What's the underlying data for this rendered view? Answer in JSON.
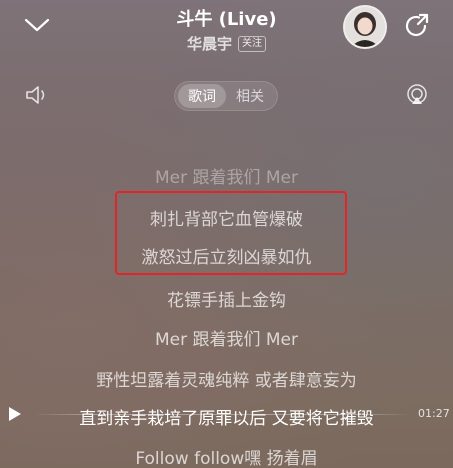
{
  "header": {
    "song_title": "斗牛 (Live)",
    "artist": "华晨宇",
    "follow_label": "关注",
    "icons": {
      "collapse": "chevron-down-icon",
      "share": "share-icon"
    }
  },
  "toolbar": {
    "tabs": [
      {
        "label": "歌词",
        "active": true
      },
      {
        "label": "相关",
        "active": false
      }
    ],
    "icons": {
      "volume": "volume-icon",
      "cast": "airplay-icon"
    }
  },
  "lyrics": {
    "lines": [
      "Mer 跟着我们 Mer",
      "刺扎背部它血管爆破",
      "激怒过后立刻凶暴如仇",
      "花镖手插上金钩",
      "Mer 跟着我们 Mer",
      "野性坦露着灵魂纯粹 或者肆意妄为",
      "直到亲手栽培了原罪以后 又要将它摧毁",
      "Follow follow嘿 扬着眉"
    ],
    "current_index": 6,
    "highlight_color": "#e0262a"
  },
  "player": {
    "time": "01:27",
    "play_icon": "play-icon"
  }
}
